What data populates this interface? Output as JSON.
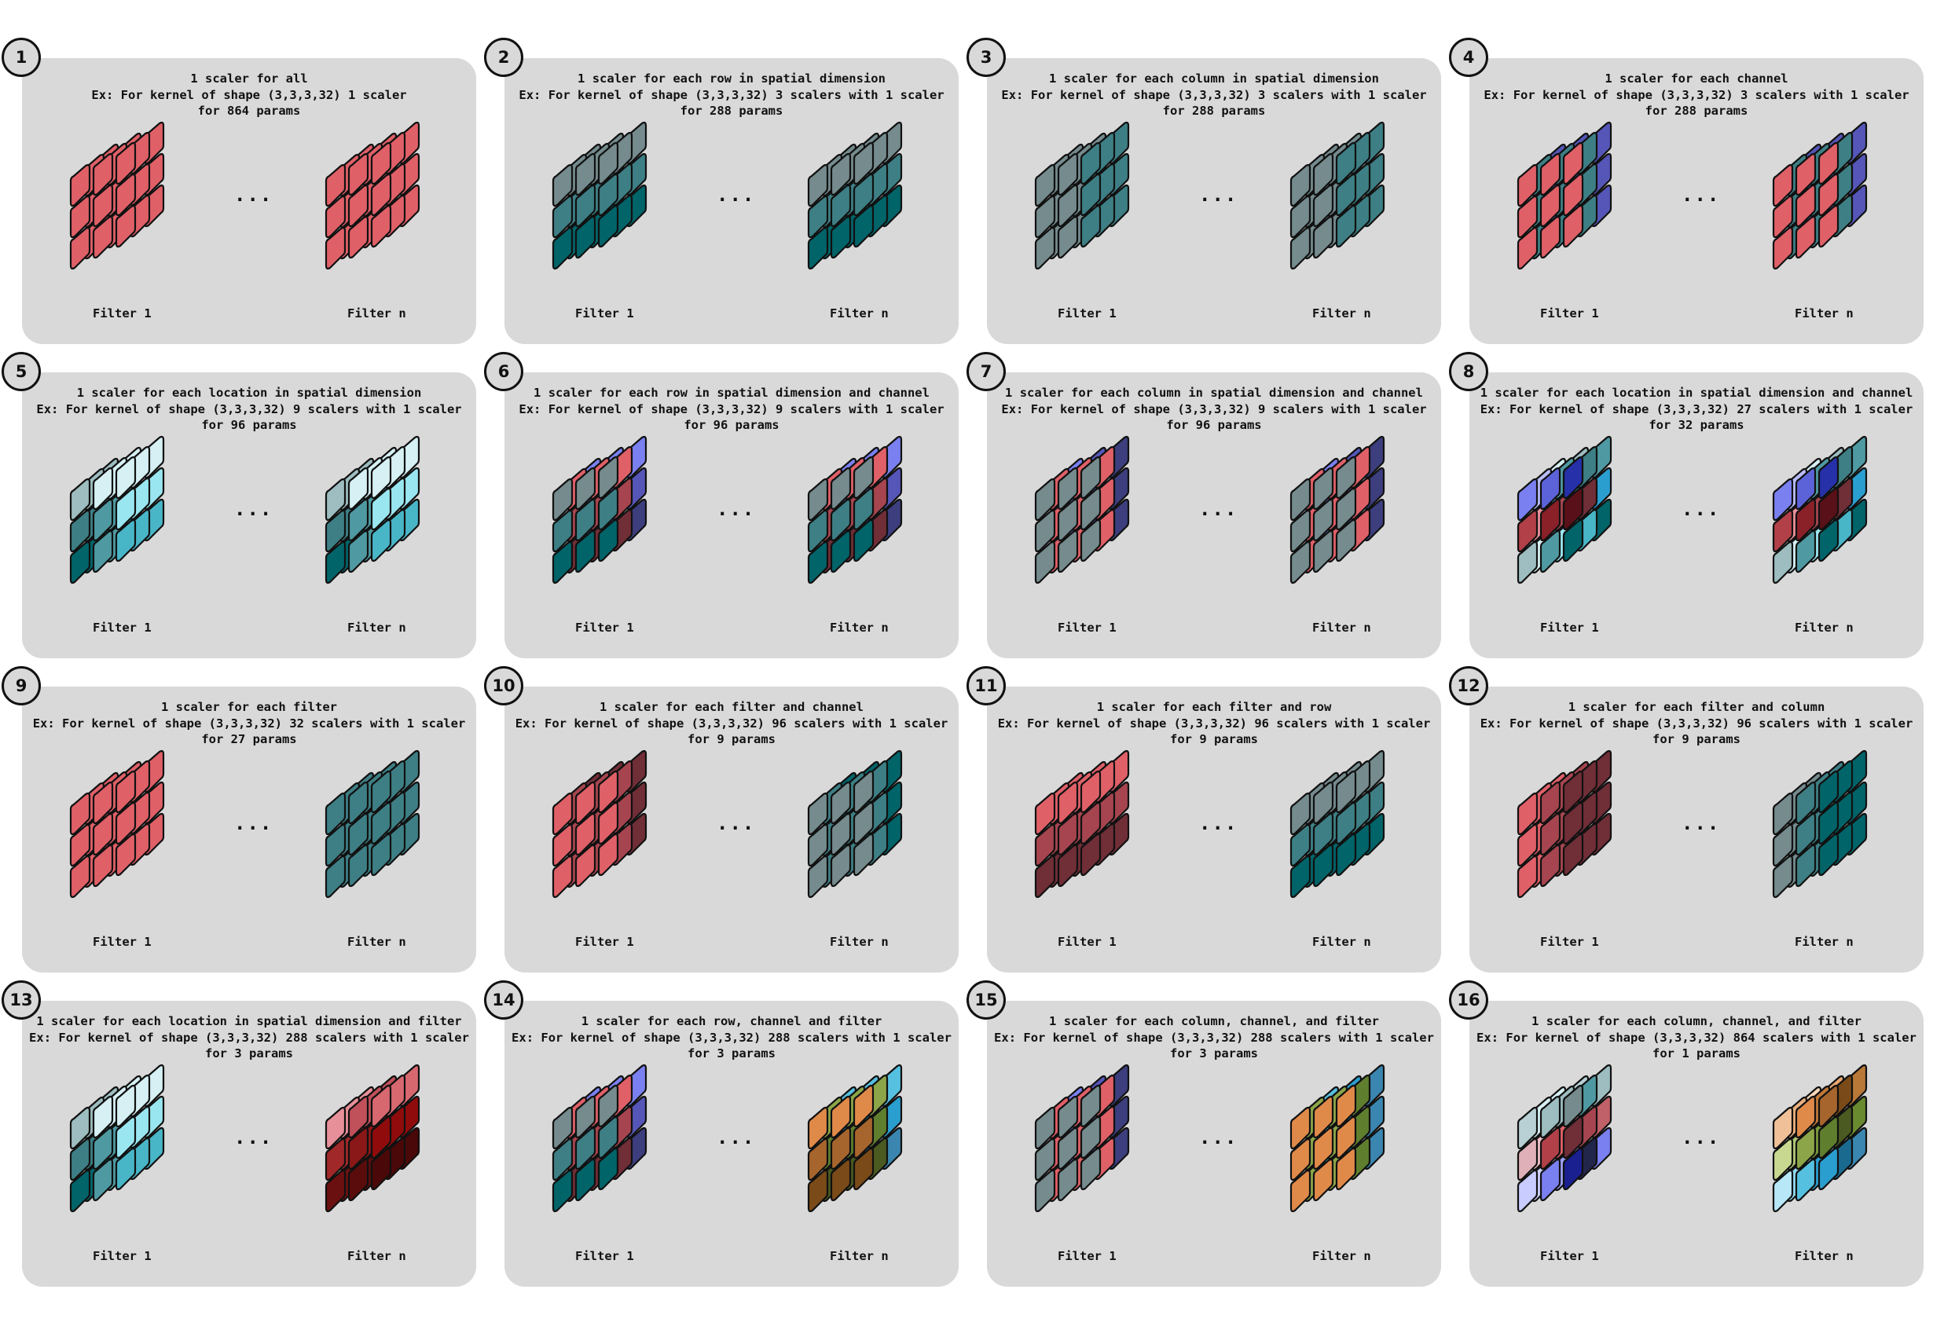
{
  "filter_1_label": "Filter 1",
  "filter_n_label": "Filter n",
  "ellipsis": "...",
  "palettes": {
    "red": [
      "#e06068",
      "#a6454f",
      "#702e37"
    ],
    "teal": [
      "#758b8e",
      "#3d7f85",
      "#006469"
    ],
    "blue": [
      "#7a80f0",
      "#5556b8",
      "#3c3e7e"
    ],
    "light": [
      "#d6f0f4",
      "#9ae6f0",
      "#49b6c8",
      "#9dbdc0",
      "#4f9aa2"
    ],
    "mixed": [
      "#e08a4a",
      "#8ca548",
      "#2b9ed0",
      "#5f7f2e",
      "#a7652e",
      "#56c0e0",
      "#3a86b0"
    ]
  },
  "panels": [
    {
      "number": "1",
      "lines": [
        "1 scaler for all",
        "Ex: For kernel of shape (3,3,3,32) 1 scaler",
        "for 864 params"
      ]
    },
    {
      "number": "2",
      "lines": [
        "1 scaler for each row in spatial dimension",
        "Ex: For kernel of shape (3,3,3,32) 3 scalers with 1 scaler",
        "for 288 params"
      ]
    },
    {
      "number": "3",
      "lines": [
        "1 scaler for each column in spatial dimension",
        "Ex: For kernel of shape (3,3,3,32) 3 scalers with 1 scaler",
        "for 288 params"
      ]
    },
    {
      "number": "4",
      "lines": [
        "1 scaler for each channel",
        "Ex: For kernel of shape (3,3,3,32) 3 scalers with 1 scaler",
        "for 288 params"
      ]
    },
    {
      "number": "5",
      "lines": [
        "1 scaler for each location in spatial dimension",
        "Ex: For kernel of shape (3,3,3,32) 9 scalers with 1 scaler",
        "for 96 params"
      ]
    },
    {
      "number": "6",
      "lines": [
        "1 scaler for each row in spatial dimension and channel",
        "Ex: For kernel of shape (3,3,3,32) 9 scalers with 1 scaler",
        "for 96 params"
      ]
    },
    {
      "number": "7",
      "lines": [
        "1 scaler for each column in spatial dimension and channel",
        "Ex: For kernel of shape (3,3,3,32) 9 scalers with 1 scaler",
        "for 96 params"
      ]
    },
    {
      "number": "8",
      "lines": [
        "1 scaler for each location in spatial dimension and channel",
        "Ex: For kernel of shape (3,3,3,32) 27 scalers with 1 scaler",
        "for 32 params"
      ]
    },
    {
      "number": "9",
      "lines": [
        "1 scaler for each filter",
        "Ex: For kernel of shape (3,3,3,32) 32 scalers with 1 scaler",
        "for 27 params"
      ]
    },
    {
      "number": "10",
      "lines": [
        "1 scaler for each filter and channel",
        "Ex: For kernel of shape (3,3,3,32) 96 scalers with 1 scaler",
        "for 9 params"
      ]
    },
    {
      "number": "11",
      "lines": [
        "1 scaler for each filter and row",
        "Ex: For kernel of shape (3,3,3,32) 96 scalers with 1 scaler",
        "for 9 params"
      ]
    },
    {
      "number": "12",
      "lines": [
        "1 scaler for each filter and column",
        "Ex: For kernel of shape (3,3,3,32) 96 scalers with 1 scaler",
        "for 9 params"
      ]
    },
    {
      "number": "13",
      "lines": [
        "1 scaler for each location in spatial dimension and filter",
        "Ex: For kernel of shape (3,3,3,32) 288 scalers with 1 scaler",
        "for 3 params"
      ]
    },
    {
      "number": "14",
      "lines": [
        "1 scaler for each row, channel and filter",
        "Ex: For kernel of shape (3,3,3,32) 288 scalers with 1 scaler",
        "for 3 params"
      ]
    },
    {
      "number": "15",
      "lines": [
        "1 scaler for each column, channel, and filter",
        "Ex: For kernel of shape (3,3,3,32) 288 scalers with 1 scaler",
        "for 3 params"
      ]
    },
    {
      "number": "16",
      "lines": [
        "1 scaler for each column, channel, and filter",
        "Ex: For kernel of shape (3,3,3,32) 864 scalers with 1 scaler",
        "for 1 params"
      ]
    }
  ]
}
